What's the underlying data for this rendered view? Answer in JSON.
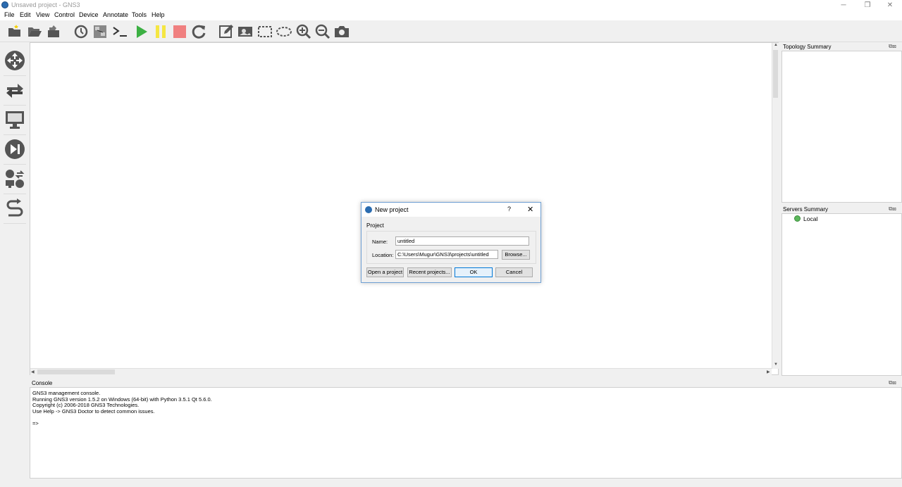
{
  "window": {
    "title": "Unsaved project - GNS3",
    "controls": [
      "─",
      "❐",
      "✕"
    ]
  },
  "menu": [
    "File",
    "Edit",
    "View",
    "Control",
    "Device",
    "Annotate",
    "Tools",
    "Help"
  ],
  "toolbar": {
    "icons": [
      "new-project-icon",
      "open-project-icon",
      "snapshot-icon",
      "history-icon",
      "show-interface-labels-icon",
      "console-icon",
      "start-icon",
      "suspend-icon",
      "stop-icon",
      "reload-icon",
      "add-note-icon",
      "insert-picture-icon",
      "draw-rectangle-icon",
      "draw-ellipse-icon",
      "zoom-in-icon",
      "zoom-out-icon",
      "screenshot-icon"
    ],
    "colors": {
      "start": "#3cb043",
      "suspend": "#f5e642",
      "stop": "#f08080"
    }
  },
  "left_devices": [
    "routers-icon",
    "switches-icon",
    "end-devices-icon",
    "security-devices-icon",
    "all-devices-icon",
    "add-link-icon"
  ],
  "panels": {
    "topology_summary": "Topology Summary",
    "servers_summary": "Servers Summary",
    "server_local": "Local",
    "server_status_color": "#5cb85c",
    "console": "Console"
  },
  "console_lines": [
    "GNS3 management console.",
    "Running GNS3 version 1.5.2 on Windows (64-bit) with Python 3.5.1 Qt 5.6.0.",
    "Copyright (c) 2006-2018 GNS3 Technologies.",
    "Use Help -> GNS3 Doctor to detect common issues.",
    "",
    "=>"
  ],
  "dialog": {
    "title": "New project",
    "help": "?",
    "close": "✕",
    "group": "Project",
    "name_label": "Name:",
    "name_value": "untitled",
    "location_label": "Location:",
    "location_value": "C:\\Users\\Mugur\\GNS3\\projects\\untitled",
    "browse": "Browse...",
    "open": "Open a project",
    "recent": "Recent projects...",
    "ok": "OK",
    "cancel": "Cancel"
  }
}
